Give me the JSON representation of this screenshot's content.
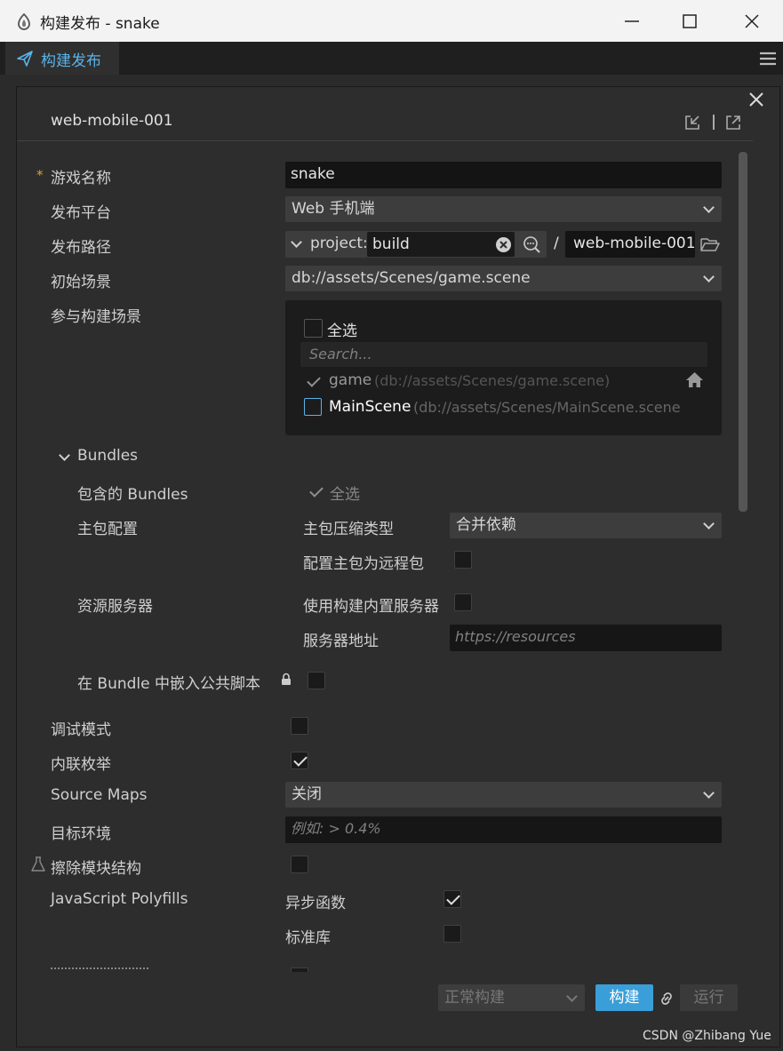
{
  "window": {
    "title": "构建发布 - snake"
  },
  "tab": {
    "label": "构建发布"
  },
  "panel": {
    "task_name": "web-mobile-001"
  },
  "form": {
    "game_name": {
      "label": "游戏名称",
      "value": "snake",
      "required": "*"
    },
    "platform": {
      "label": "发布平台",
      "value": "Web 手机端"
    },
    "build_path": {
      "label": "发布路径",
      "prefix": "project:",
      "value": "build",
      "separator": "/",
      "output": "web-mobile-001"
    },
    "start_scene": {
      "label": "初始场景",
      "value": "db://assets/Scenes/game.scene"
    },
    "included_scenes": {
      "label": "参与构建场景",
      "select_all": "全选",
      "search_placeholder": "Search...",
      "scenes": [
        {
          "name": "game",
          "path": "(db://assets/Scenes/game.scene)",
          "checked": true
        },
        {
          "name": "MainScene",
          "path": "(db://assets/Scenes/MainScene.scene",
          "checked": false
        }
      ]
    },
    "bundles": {
      "header": "Bundles",
      "included_label": "包含的 Bundles",
      "included_value": "全选",
      "main_config_label": "主包配置",
      "compression_label": "主包压缩类型",
      "compression_value": "合并依赖",
      "remote_label": "配置主包为远程包",
      "resource_server_label": "资源服务器",
      "builtin_server_label": "使用构建内置服务器",
      "server_address_label": "服务器地址",
      "server_address_placeholder": "https://resources",
      "embed_label": "在 Bundle 中嵌入公共脚本"
    },
    "debug_mode": {
      "label": "调试模式",
      "checked": false
    },
    "inline_enum": {
      "label": "内联枚举",
      "checked": true
    },
    "source_maps": {
      "label": "Source Maps",
      "value": "关闭"
    },
    "target_env": {
      "label": "目标环境",
      "placeholder": "例如: > 0.4%"
    },
    "erase_module": {
      "label": "擦除模块结构",
      "checked": false
    },
    "polyfills": {
      "label": "JavaScript Polyfills",
      "async_label": "异步函数",
      "async_checked": true,
      "stdlib_label": "标准库",
      "stdlib_checked": false
    }
  },
  "footer": {
    "build_type": "正常构建",
    "build_button": "构建",
    "run_button": "运行"
  },
  "watermark": "CSDN @Zhibang Yue"
}
